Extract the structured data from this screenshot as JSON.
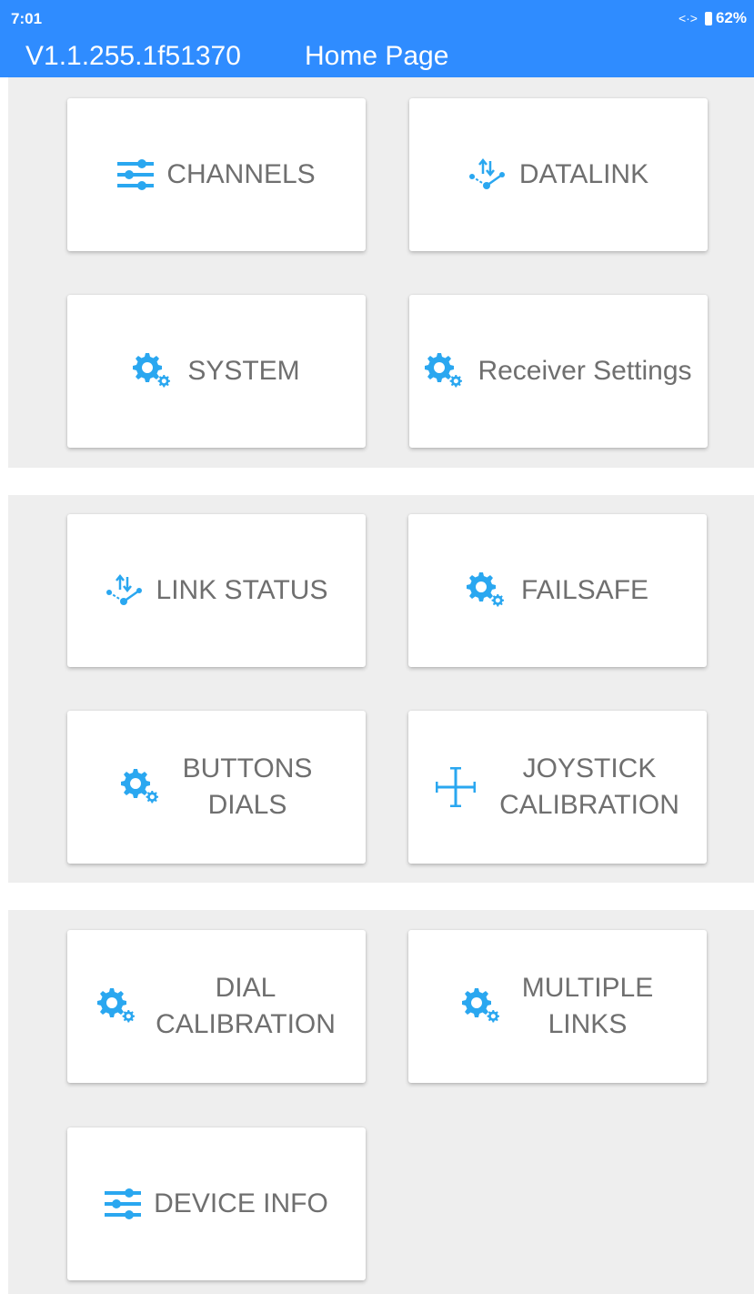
{
  "status_bar": {
    "time": "7:01",
    "link_glyph": "<·>",
    "battery": "62%"
  },
  "header": {
    "version": "V1.1.255.1f51370",
    "title": "Home Page"
  },
  "colors": {
    "accent": "#2f8cff",
    "icon": "#2aa7f0",
    "panel_bg": "#eeeeee",
    "label": "#6f6f6f"
  },
  "tiles": [
    {
      "label": "CHANNELS",
      "icon": "sliders-icon"
    },
    {
      "label": "DATALINK",
      "icon": "datalink-icon"
    },
    {
      "label": "SYSTEM",
      "icon": "gear-icon"
    },
    {
      "label": "Receiver Settings",
      "icon": "gear-icon"
    },
    {
      "label": "LINK STATUS",
      "icon": "datalink-icon"
    },
    {
      "label": "FAILSAFE",
      "icon": "gear-icon"
    },
    {
      "lines": [
        "BUTTONS",
        "DIALS"
      ],
      "icon": "gear-icon"
    },
    {
      "lines": [
        "JOYSTICK",
        "CALIBRATION"
      ],
      "icon": "crosshair-icon"
    },
    {
      "lines": [
        "DIAL",
        "CALIBRATION"
      ],
      "icon": "gear-icon"
    },
    {
      "lines": [
        "MULTIPLE",
        "LINKS"
      ],
      "icon": "gear-icon"
    },
    {
      "label": "DEVICE INFO",
      "icon": "sliders-icon"
    }
  ]
}
